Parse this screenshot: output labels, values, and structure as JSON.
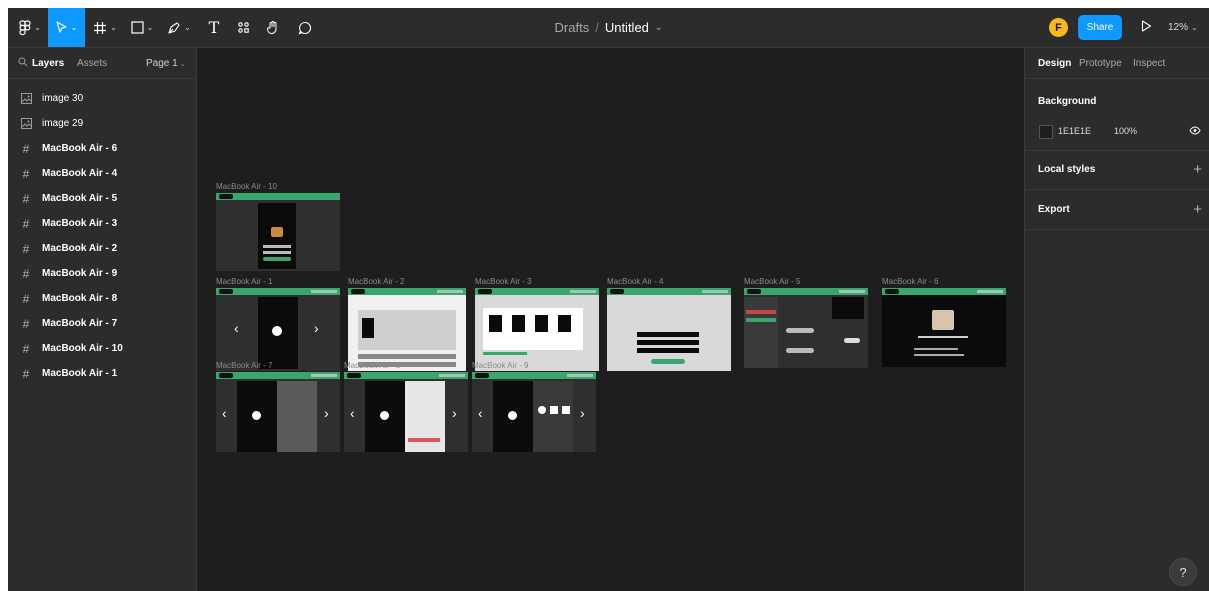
{
  "toolbar": {
    "main_menu_icon": "figma-logo-icon",
    "tools": [
      "move-tool",
      "frame-tool",
      "shape-tool",
      "pen-tool",
      "text-tool",
      "resources-tool",
      "hand-tool",
      "comment-tool"
    ],
    "text_tool_glyph": "T"
  },
  "breadcrumb": {
    "drafts": "Drafts",
    "separator": "/",
    "file": "Untitled"
  },
  "user": {
    "avatar_initial": "F"
  },
  "share_label": "Share",
  "zoom": "12%",
  "left_panel": {
    "layers_tab": "Layers",
    "assets_tab": "Assets",
    "page": "Page 1",
    "layers": [
      {
        "name": "image 30",
        "type": "image"
      },
      {
        "name": "image 29",
        "type": "image"
      },
      {
        "name": "MacBook Air - 6",
        "type": "frame"
      },
      {
        "name": "MacBook Air - 4",
        "type": "frame"
      },
      {
        "name": "MacBook Air - 5",
        "type": "frame"
      },
      {
        "name": "MacBook Air - 3",
        "type": "frame"
      },
      {
        "name": "MacBook Air - 2",
        "type": "frame"
      },
      {
        "name": "MacBook Air - 9",
        "type": "frame"
      },
      {
        "name": "MacBook Air - 8",
        "type": "frame"
      },
      {
        "name": "MacBook Air - 7",
        "type": "frame"
      },
      {
        "name": "MacBook Air - 10",
        "type": "frame"
      },
      {
        "name": "MacBook Air - 1",
        "type": "frame"
      }
    ]
  },
  "right_panel": {
    "tabs": [
      "Design",
      "Prototype",
      "Inspect"
    ],
    "background_title": "Background",
    "background_hex": "1E1E1E",
    "background_opacity": "100%",
    "local_styles": "Local styles",
    "export": "Export"
  },
  "canvas": {
    "frame_labels": {
      "f10": "MacBook Air - 10",
      "f1": "MacBook Air - 1",
      "f2": "MacBook Air - 2",
      "f3": "MacBook Air - 3",
      "f4": "MacBook Air - 4",
      "f5": "MacBook Air - 5",
      "f6": "MacBook Air - 6",
      "f7": "MacBook Air - 7",
      "f8": "MacBook Air - 8",
      "f9": "MacBook Air - 9"
    }
  },
  "help_label": "?",
  "colors": {
    "accent": "#0d99ff",
    "frame_green": "#3aa56d",
    "avatar": "#f9b81b",
    "canvas_bg": "#1e1e1e",
    "panel_bg": "#2c2c2c"
  }
}
